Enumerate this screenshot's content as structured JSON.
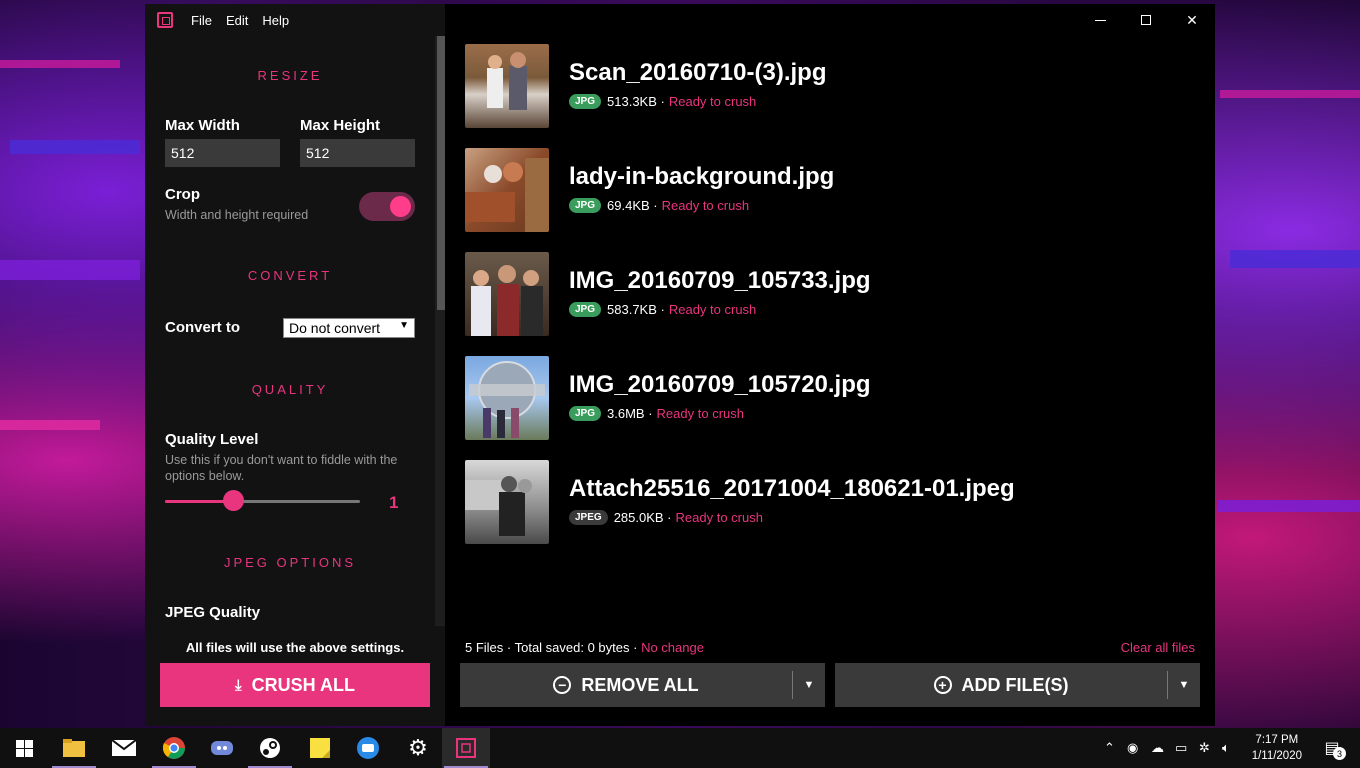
{
  "menu": {
    "file": "File",
    "edit": "Edit",
    "help": "Help"
  },
  "resize": {
    "title": "RESIZE",
    "max_width_label": "Max Width",
    "max_height_label": "Max Height",
    "max_width_value": "512",
    "max_height_value": "512",
    "crop_label": "Crop",
    "crop_sub": "Width and height required",
    "crop_enabled": true
  },
  "convert": {
    "title": "CONVERT",
    "label": "Convert to",
    "selected": "Do not convert"
  },
  "quality": {
    "title": "QUALITY",
    "label": "Quality Level",
    "sub": "Use this if you don't want to fiddle with the options below.",
    "value": "1",
    "slider_fraction": 0.35
  },
  "jpeg": {
    "title": "JPEG OPTIONS",
    "quality_label": "JPEG Quality"
  },
  "footer": {
    "note": "All files will use the above settings.",
    "crush_all": "CRUSH ALL"
  },
  "files": [
    {
      "name": "Scan_20160710-(3).jpg",
      "type": "JPG",
      "size": "513.3KB",
      "status": "Ready to crush",
      "thumb": "thumb-kids"
    },
    {
      "name": "lady-in-background.jpg",
      "type": "JPG",
      "size": "69.4KB",
      "status": "Ready to crush",
      "thumb": "thumb-restaurant"
    },
    {
      "name": "IMG_20160709_105733.jpg",
      "type": "JPG",
      "size": "583.7KB",
      "status": "Ready to crush",
      "thumb": "thumb-group"
    },
    {
      "name": "IMG_20160709_105720.jpg",
      "type": "JPG",
      "size": "3.6MB",
      "status": "Ready to crush",
      "thumb": "thumb-universal"
    },
    {
      "name": "Attach25516_20171004_180621-01.jpeg",
      "type": "JPEG",
      "size": "285.0KB",
      "status": "Ready to crush",
      "thumb": "thumb-bw"
    }
  ],
  "summary": {
    "text": "5 Files · Total saved: 0 bytes ·",
    "change": "No change",
    "clear_all": "Clear all files"
  },
  "buttons": {
    "remove_all": "REMOVE ALL",
    "add_files": "ADD FILE(S)"
  },
  "taskbar": {
    "time": "7:17 PM",
    "date": "1/11/2020",
    "notifications": "3"
  },
  "colors": {
    "accent": "#e8357e",
    "jpg_badge": "#3a9d5d",
    "jpeg_badge": "#3a3a3a"
  }
}
